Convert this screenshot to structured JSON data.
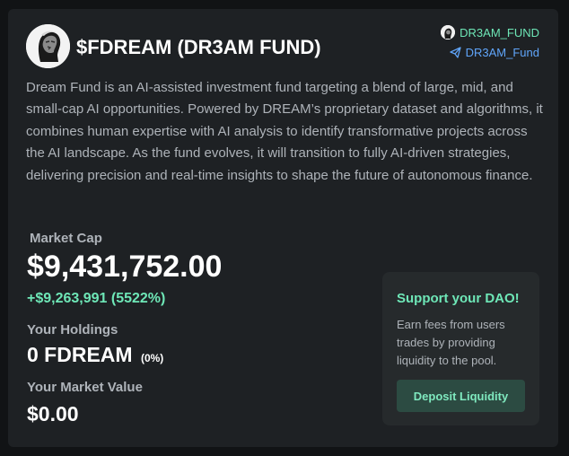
{
  "fund": {
    "title": "$FDREAM (DR3AM FUND)",
    "description": "Dream Fund is an AI-assisted investment fund targeting a blend of large, mid, and small-cap AI opportunities. Powered by DREAM’s proprietary dataset and algorithms, it combines human expertise with AI analysis to identify transformative projects across the AI landscape. As the fund evolves, it will transition to fully AI-driven strategies, delivering precision and real-time insights to shape the future of autonomous finance."
  },
  "social": {
    "fund_handle": "DR3AM_FUND",
    "telegram_handle": "DR3AM_Fund",
    "icons": [
      "avatar-icon",
      "telegram-icon"
    ]
  },
  "stats": {
    "market_cap_label": "Market Cap",
    "market_cap_value": "$9,431,752.00",
    "market_cap_change": "+$9,263,991 (5522%)",
    "holdings_label": "Your Holdings",
    "holdings_value": "0 FDREAM",
    "holdings_pct": "(0%)",
    "market_value_label": "Your Market Value",
    "market_value": "$0.00"
  },
  "dao": {
    "title": "Support your DAO!",
    "text": "Earn fees from users trades by providing liquidity to the pool.",
    "button_label": "Deposit Liquidity"
  },
  "colors": {
    "background": "#111315",
    "card": "#1e2124",
    "accent_green": "#6ee7b7",
    "link_blue": "#60a5fa",
    "muted_text": "#aeb3b9"
  }
}
